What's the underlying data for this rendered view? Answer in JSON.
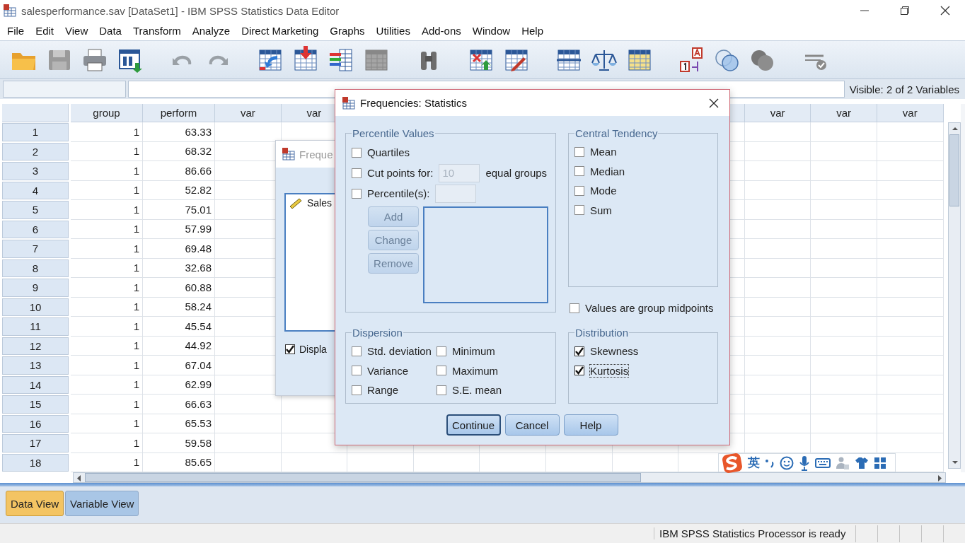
{
  "window": {
    "title": "salesperformance.sav [DataSet1] - IBM SPSS Statistics Data Editor"
  },
  "menu": [
    "File",
    "Edit",
    "View",
    "Data",
    "Transform",
    "Analyze",
    "Direct Marketing",
    "Graphs",
    "Utilities",
    "Add-ons",
    "Window",
    "Help"
  ],
  "cell_editor": {
    "visible_label": "Visible: 2 of 2 Variables"
  },
  "grid": {
    "columns_left": [
      "group",
      "perform",
      "var",
      "var"
    ],
    "columns_right": [
      "var",
      "var",
      "var"
    ],
    "rows": [
      {
        "number": "1",
        "group": "1",
        "perform": "63.33"
      },
      {
        "number": "2",
        "group": "1",
        "perform": "68.32"
      },
      {
        "number": "3",
        "group": "1",
        "perform": "86.66"
      },
      {
        "number": "4",
        "group": "1",
        "perform": "52.82"
      },
      {
        "number": "5",
        "group": "1",
        "perform": "75.01"
      },
      {
        "number": "6",
        "group": "1",
        "perform": "57.99"
      },
      {
        "number": "7",
        "group": "1",
        "perform": "69.48"
      },
      {
        "number": "8",
        "group": "1",
        "perform": "32.68"
      },
      {
        "number": "9",
        "group": "1",
        "perform": "60.88"
      },
      {
        "number": "10",
        "group": "1",
        "perform": "58.24"
      },
      {
        "number": "11",
        "group": "1",
        "perform": "45.54"
      },
      {
        "number": "12",
        "group": "1",
        "perform": "44.92"
      },
      {
        "number": "13",
        "group": "1",
        "perform": "67.04"
      },
      {
        "number": "14",
        "group": "1",
        "perform": "62.99"
      },
      {
        "number": "15",
        "group": "1",
        "perform": "66.63"
      },
      {
        "number": "16",
        "group": "1",
        "perform": "65.53"
      },
      {
        "number": "17",
        "group": "1",
        "perform": "59.58"
      },
      {
        "number": "18",
        "group": "1",
        "perform": "85.65"
      }
    ]
  },
  "view_tabs": [
    {
      "label": "Data View",
      "selected": true
    },
    {
      "label": "Variable View",
      "selected": false
    }
  ],
  "status_bar": {
    "message": "IBM SPSS Statistics Processor is ready"
  },
  "background_dialog": {
    "title": "Freque",
    "list_item": "Sales",
    "checkbox": {
      "label": "Displa",
      "checked": true
    }
  },
  "dialog": {
    "title": "Frequencies: Statistics",
    "percentile_values": {
      "title": "Percentile Values",
      "options": [
        {
          "kind": "check",
          "label": "Quartiles",
          "checked": false
        },
        {
          "kind": "cut",
          "label": "Cut points for:",
          "checked": false,
          "value": "10",
          "suffix": "equal groups"
        },
        {
          "kind": "field",
          "label": "Percentile(s):",
          "checked": false
        }
      ],
      "buttons": [
        {
          "label": "Add",
          "disabled": true
        },
        {
          "label": "Change",
          "disabled": true
        },
        {
          "label": "Remove",
          "disabled": true
        }
      ]
    },
    "central_tendency": {
      "title": "Central Tendency",
      "options": [
        {
          "label": "Mean",
          "checked": false
        },
        {
          "label": "Median",
          "checked": false
        },
        {
          "label": "Mode",
          "checked": false
        },
        {
          "label": "Sum",
          "checked": false
        }
      ]
    },
    "group_midpoints": {
      "label": "Values are group midpoints",
      "checked": false
    },
    "dispersion": {
      "title": "Dispersion",
      "options": [
        {
          "label": "Std. deviation",
          "checked": false
        },
        {
          "label": "Minimum",
          "checked": false
        },
        {
          "label": "Variance",
          "checked": false
        },
        {
          "label": "Maximum",
          "checked": false
        },
        {
          "label": "Range",
          "checked": false
        },
        {
          "label": "S.E. mean",
          "checked": false
        }
      ]
    },
    "distribution": {
      "title": "Distribution",
      "options": [
        {
          "label": "Skewness",
          "checked": true,
          "focused": false
        },
        {
          "label": "Kurtosis",
          "checked": true,
          "focused": true
        }
      ]
    },
    "buttons": [
      {
        "label": "Continue",
        "default": true
      },
      {
        "label": "Cancel",
        "default": false
      },
      {
        "label": "Help",
        "default": false
      }
    ]
  },
  "ime_bar": {
    "language": "英"
  }
}
